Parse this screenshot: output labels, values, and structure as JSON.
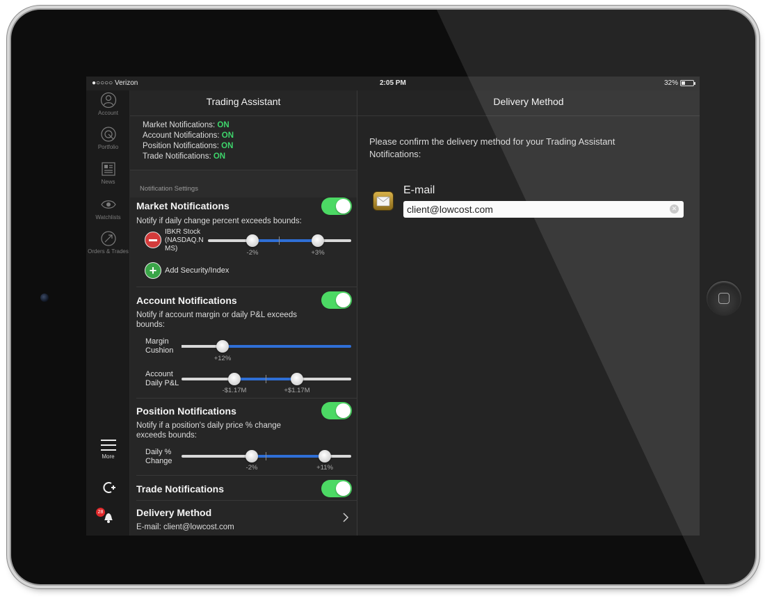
{
  "status_bar": {
    "carrier": "●○○○○ Verizon",
    "time": "2:05 PM",
    "battery": "32%",
    "battery_level": 0.32
  },
  "sidebar": {
    "items": [
      {
        "label": "Account",
        "icon": "person-icon"
      },
      {
        "label": "Portfolio",
        "icon": "pie-chart-icon"
      },
      {
        "label": "News",
        "icon": "newspaper-icon"
      },
      {
        "label": "Watchlists",
        "icon": "eye-icon"
      },
      {
        "label": "Orders & Trades",
        "icon": "order-icon"
      }
    ],
    "more_label": "More",
    "notification_badge": "28"
  },
  "left_panel": {
    "title": "Trading Assistant",
    "summary": [
      {
        "label": "Market Notifications:",
        "value": "ON"
      },
      {
        "label": "Account Notifications:",
        "value": "ON"
      },
      {
        "label": "Position Notifications:",
        "value": "ON"
      },
      {
        "label": "Trade Notifications:",
        "value": "ON"
      }
    ],
    "section_header": "Notification Settings",
    "market": {
      "title": "Market Notifications",
      "enabled": true,
      "description": "Notify if daily change percent exceeds bounds:",
      "security": "IBKR Stock (NASDAQ.N MS)",
      "low_label": "-2%",
      "high_label": "+3%",
      "low_value": -2,
      "high_value": 3,
      "add_label": "Add Security/Index"
    },
    "account": {
      "title": "Account Notifications",
      "enabled": true,
      "description": "Notify if account margin or daily P&L exceeds bounds:",
      "margin_label": "Margin Cushion",
      "margin_value_label": "+12%",
      "margin_value": 12,
      "pnl_label": "Account Daily P&L",
      "pnl_low_label": "-$1.17M",
      "pnl_high_label": "+$1.17M"
    },
    "position": {
      "title": "Position Notifications",
      "enabled": true,
      "description": "Notify if a position's daily price % change exceeds bounds:",
      "change_label": "Daily % Change",
      "low_label": "-2%",
      "high_label": "+11%",
      "low_value": -2,
      "high_value": 11
    },
    "trade": {
      "title": "Trade Notifications",
      "enabled": true
    },
    "delivery": {
      "title": "Delivery Method",
      "value": "E-mail: client@lowcost.com"
    }
  },
  "right_panel": {
    "title": "Delivery Method",
    "description": "Please confirm the delivery method for your Trading Assistant Notifications:",
    "email_label": "E-mail",
    "email_value": "client@lowcost.com"
  },
  "colors": {
    "on_green": "#3ed46b",
    "toggle_green": "#4cd964",
    "slider_blue": "#2f6fd6",
    "remove_red": "#d33b3b",
    "add_green": "#3aa548"
  }
}
